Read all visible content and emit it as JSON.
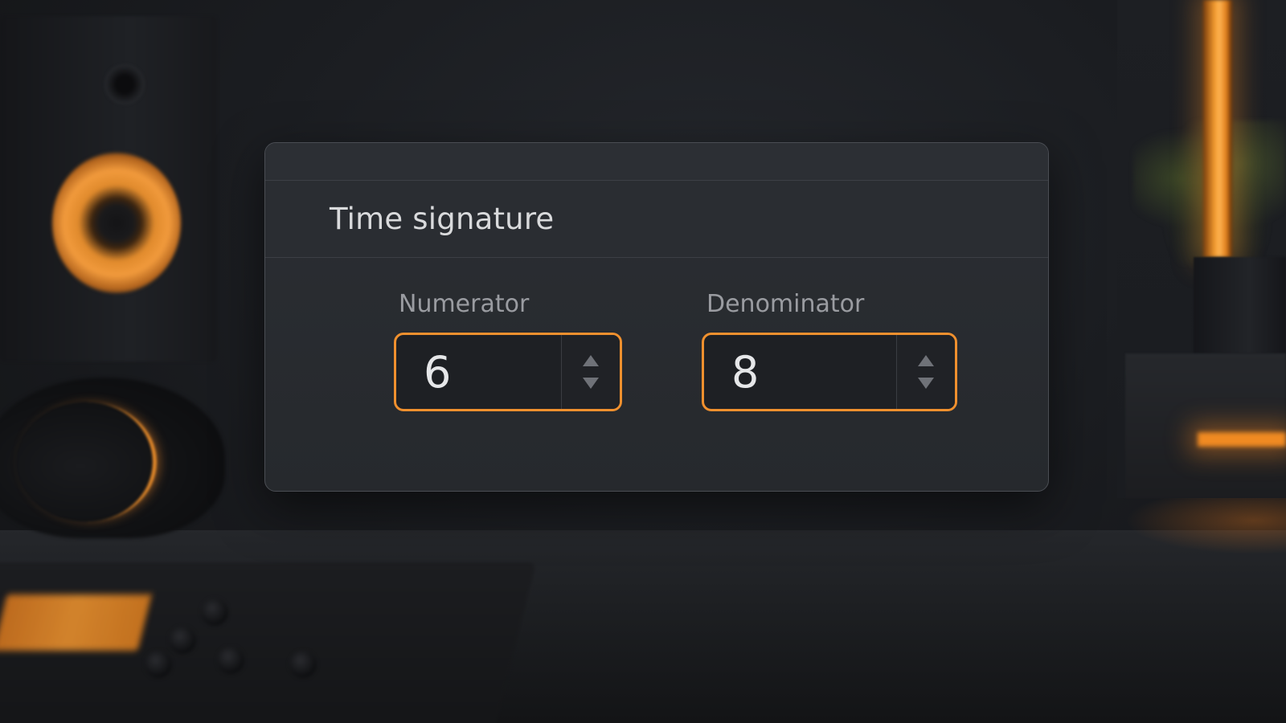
{
  "dialog": {
    "title": "Time signature"
  },
  "numerator": {
    "label": "Numerator",
    "value": "6"
  },
  "denominator": {
    "label": "Denominator",
    "value": "8"
  },
  "icons": {
    "increment": "arrow-up-icon",
    "decrement": "arrow-down-icon"
  },
  "colors": {
    "accent": "#f0902e",
    "dialog_bg": "#2a2d32",
    "field_bg": "#1e2024",
    "text_primary": "#e6e7e9",
    "text_secondary": "#9a9ca1"
  }
}
